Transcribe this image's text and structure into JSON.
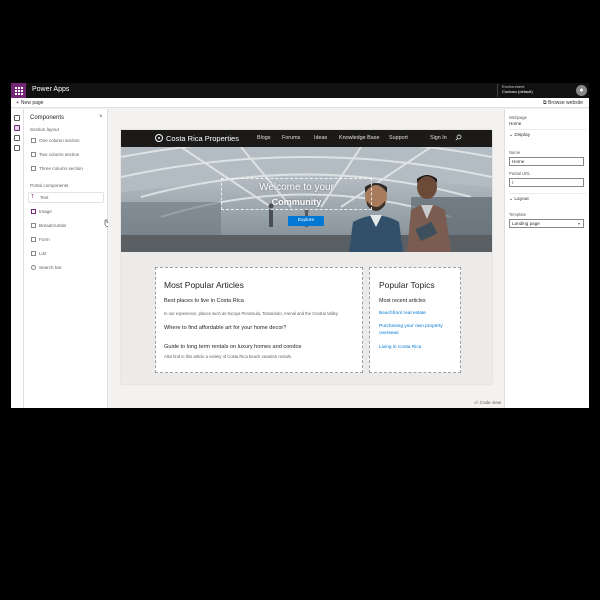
{
  "topbar": {
    "app_name": "Power Apps",
    "env_label": "Environment",
    "env_name": "Contoso (default)",
    "avatar": ""
  },
  "cmdbar": {
    "new_page": "New page",
    "browse_website": "Browse website"
  },
  "components_panel": {
    "title": "Components",
    "section_layouts_heading": "Section layout",
    "section_layouts": [
      "One column section",
      "Two column section",
      "Three column section"
    ],
    "portal_components_heading": "Portal components",
    "portal_components": [
      "Text",
      "Image",
      "Breadcrumbs",
      "Form",
      "List",
      "Search bar"
    ]
  },
  "site": {
    "name": "Costa Rica Properties",
    "nav": [
      "Blogs",
      "Forums",
      "Ideas",
      "Knowledge Base",
      "Support",
      "Sign In"
    ],
    "hero_title": "Welcome to your",
    "hero_subtitle": "Community",
    "explore_label": "Explore",
    "articles": {
      "heading": "Most Popular Articles",
      "items": [
        {
          "title": "Best places to live in Costa Rica",
          "desc": "In our experience, places such as Nicoya Peninsula, Tamarindo, Arenal and the Central Valley"
        },
        {
          "title": "Where to find affordable art for your home decor?",
          "desc": ""
        },
        {
          "title": "Guide to long term rentals on luxury homes and condos",
          "desc": "Also find in this article a variety of Costa Rica beach vacation rentals."
        }
      ]
    },
    "topics": {
      "heading": "Popular Topics",
      "subheading": "Most recent articles",
      "links": [
        "Beachfront real estate",
        "Purchasing your own property overseas",
        "Living in Costa Rica"
      ]
    }
  },
  "properties_panel": {
    "page_label": "Webpage",
    "page_value": "Home",
    "display_section": "Display",
    "name_label": "Name",
    "name_value": "Home",
    "partial_url_label": "Partial URL",
    "partial_url_value": "/",
    "layout_section": "Layout",
    "template_label": "Template",
    "template_value": "Landing page"
  },
  "footer": {
    "code_view": "Code view"
  },
  "colors": {
    "accent": "#742774",
    "link": "#0078d4",
    "nav_bg": "#1b1a19"
  }
}
